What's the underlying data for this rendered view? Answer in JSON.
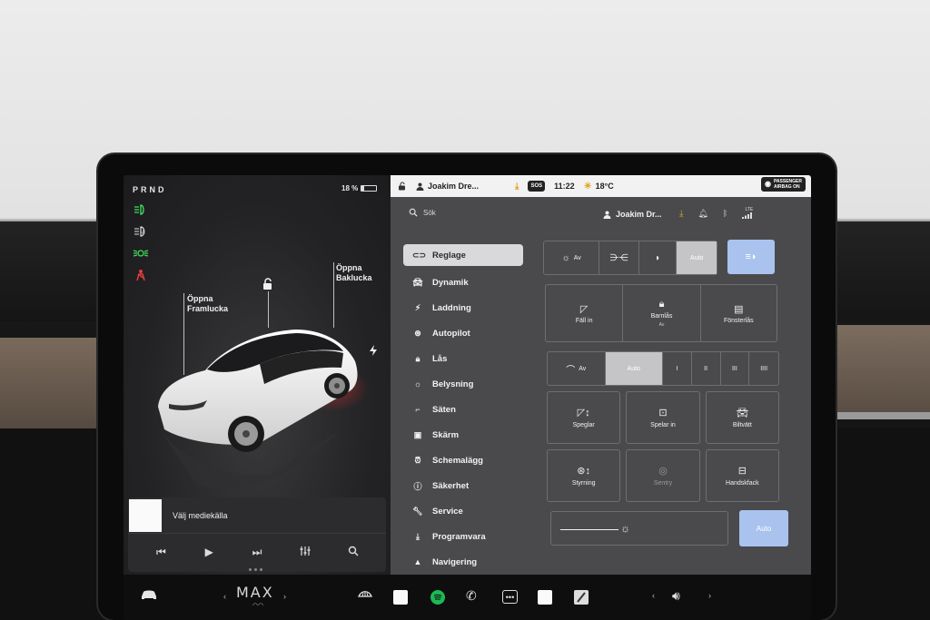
{
  "vehicle": {
    "gear": "PRND",
    "battery_percent": "18 %",
    "battery_level": 0.18,
    "callouts": {
      "frunk": [
        "Öppna",
        "Framlucka"
      ],
      "trunk": [
        "Öppna",
        "Baklucka"
      ]
    }
  },
  "indicators": [
    "low-beam-icon",
    "auto-high-beam-icon",
    "parking-lights-icon",
    "seatbelt-warning-icon"
  ],
  "media": {
    "source_label": "Välj mediekälla",
    "controls": [
      "previous-icon",
      "play-icon",
      "next-icon",
      "equalizer-icon",
      "search-icon"
    ]
  },
  "status_bar": {
    "user": "Joakim Dre...",
    "sos": "SOS",
    "time": "11:22",
    "temperature": "18°C",
    "airbag": [
      "PASSENGER",
      "AIRBAG ON"
    ],
    "lte": "LTE"
  },
  "search": {
    "placeholder": "Sök",
    "user": "Joakim Dr..."
  },
  "menu": [
    {
      "label": "Reglage",
      "icon": "toggle-icon"
    },
    {
      "label": "Dynamik",
      "icon": "car-icon"
    },
    {
      "label": "Laddning",
      "icon": "bolt-icon"
    },
    {
      "label": "Autopilot",
      "icon": "steering-wheel-icon"
    },
    {
      "label": "Lås",
      "icon": "lock-icon"
    },
    {
      "label": "Belysning",
      "icon": "sun-icon"
    },
    {
      "label": "Säten",
      "icon": "seat-icon"
    },
    {
      "label": "Skärm",
      "icon": "display-icon"
    },
    {
      "label": "Schemalägg",
      "icon": "clock-icon"
    },
    {
      "label": "Säkerhet",
      "icon": "info-icon"
    },
    {
      "label": "Service",
      "icon": "wrench-icon"
    },
    {
      "label": "Programvara",
      "icon": "download-icon"
    },
    {
      "label": "Navigering",
      "icon": "navigation-icon"
    }
  ],
  "controls": {
    "headlights": {
      "off": "Av",
      "auto": "Auto"
    },
    "locks": {
      "fold": "Fäll in",
      "child_lock": "Barnlås",
      "child_lock_state": "Av",
      "window_lock": "Fönsterlås"
    },
    "wipers": {
      "off": "Av",
      "auto": "Auto",
      "speeds": [
        "I",
        "II",
        "III",
        "IIII"
      ]
    },
    "grid": {
      "mirrors": "Speglar",
      "dashcam": "Spelar in",
      "car_wash": "Biltvätt",
      "steering": "Styrning",
      "sentry": "Sentry",
      "glovebox": "Handskfack"
    },
    "brightness": {
      "level": 0.4,
      "auto": "Auto"
    }
  },
  "dock": {
    "climate_label": "MAX"
  }
}
